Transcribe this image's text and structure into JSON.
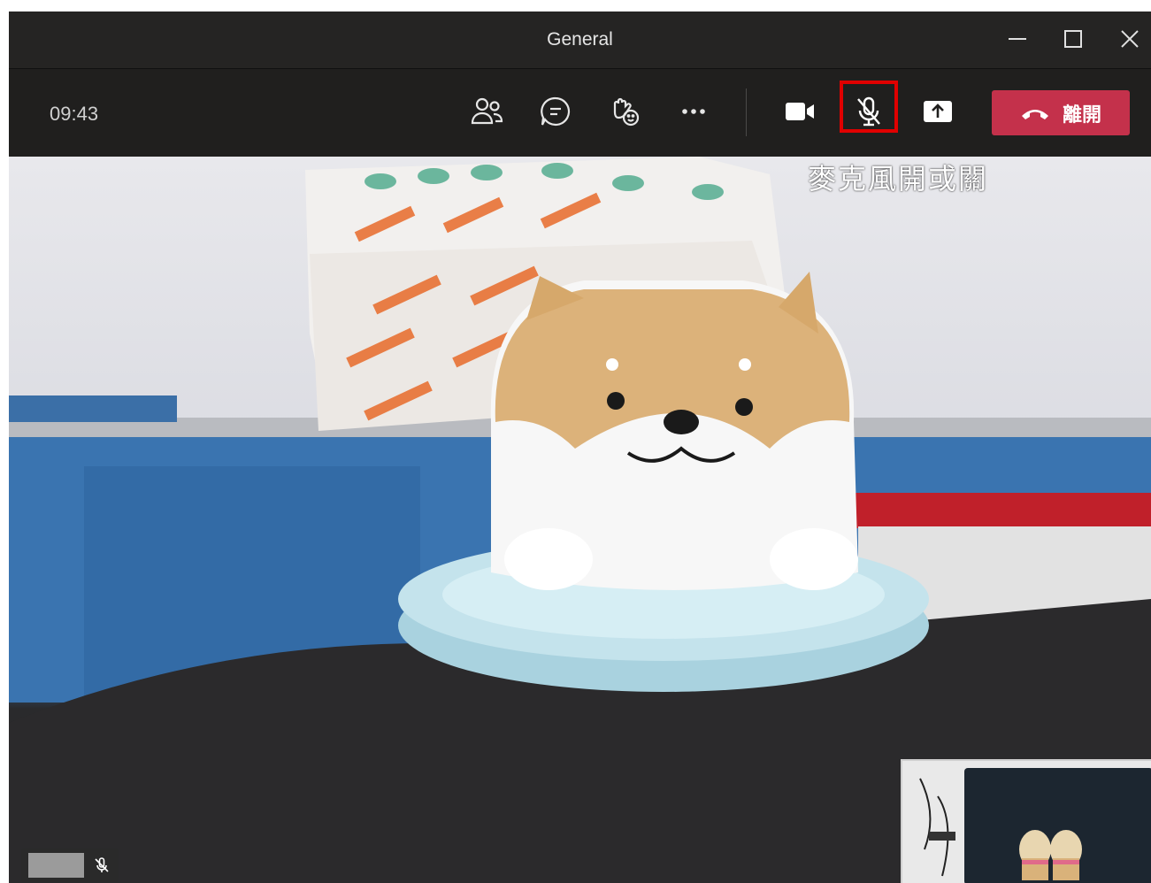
{
  "window": {
    "title": "General"
  },
  "toolbar": {
    "timer": "09:43",
    "leave_label": "離開"
  },
  "annotation": {
    "text": "麥克風開或關"
  },
  "icons": {
    "minimize": "minimize-icon",
    "maximize": "maximize-icon",
    "close": "close-icon",
    "participants": "participants-icon",
    "chat": "chat-icon",
    "reactions": "raise-hand-reactions-icon",
    "more": "more-options-icon",
    "camera": "camera-icon",
    "mic": "microphone-muted-icon",
    "share": "share-screen-icon",
    "hangup": "phone-hangup-icon"
  },
  "colors": {
    "leave_button": "#c4314b",
    "highlight": "#e00000",
    "toolbar_bg": "#201f1e"
  }
}
